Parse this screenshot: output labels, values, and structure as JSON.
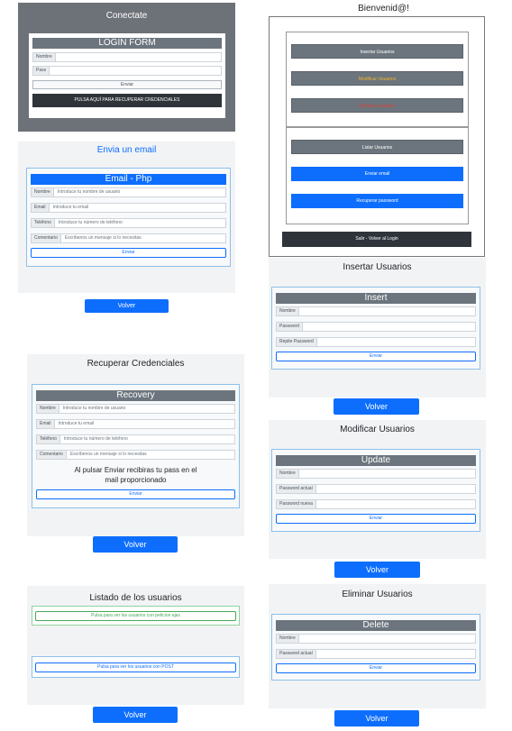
{
  "login": {
    "title": "Conectate",
    "form_title": "LOGIN FORM",
    "name_label": "Nombre",
    "pass_label": "Pass",
    "submit": "Enviar",
    "recover": "PULSA AQUÍ PARA RECUPERAR CREDENCIALES"
  },
  "menu": {
    "title": "Bienvenid@!",
    "items": [
      "Insertar Usuarios",
      "Modificar Usuarios",
      "Eliminar Usuarios"
    ],
    "list_users": "Listar Usuarios",
    "send_email": "Enviar email",
    "recover_password": "Recuperar password",
    "logout": "Salir - Volver al Login",
    "colors": {
      "modify": "#f0b429",
      "delete": "#e0413a"
    }
  },
  "email": {
    "title": "Envia un email",
    "form_title": "Email - Php",
    "fields": [
      {
        "label": "Nombre",
        "placeholder": "Introduce tu nombre de usuario"
      },
      {
        "label": "Email",
        "placeholder": "Introduce tu email"
      },
      {
        "label": "Teléfono",
        "placeholder": "Introduce tu número de teléfono"
      },
      {
        "label": "Comentario",
        "placeholder": "Escribenos un mensaje si lo necesitas"
      }
    ],
    "submit": "Enviar",
    "back": "Volver"
  },
  "insert": {
    "title": "Insertar Usuarios",
    "form_title": "Insert",
    "fields": [
      "Nombre",
      "Password",
      "Repite Password"
    ],
    "submit": "Enviar",
    "back": "Volver"
  },
  "recovery": {
    "title": "Recuperar Credenciales",
    "form_title": "Recovery",
    "fields": [
      {
        "label": "Nombre",
        "placeholder": "Introduce tu nombre de usuario"
      },
      {
        "label": "Email",
        "placeholder": "Introduce tu email"
      },
      {
        "label": "Teléfono",
        "placeholder": "Introduce tu número de teléfono"
      },
      {
        "label": "Comentario",
        "placeholder": "Escribenos un mensaje si lo necesitas"
      }
    ],
    "note": "Al pulsar Enviar recibiras tu pass en el mail proporcionado",
    "submit": "Enviar",
    "back": "Volver"
  },
  "modify": {
    "title": "Modificar Usuarios",
    "form_title": "Update",
    "fields": [
      "Nombre",
      "Password actual",
      "Password nueva"
    ],
    "submit": "Enviar",
    "back": "Volver"
  },
  "listing": {
    "title": "Listado de los usuarios",
    "ajax_button": "Pulsa para ver los usuarios con peticion ajax",
    "post_button": "Pulsa para ver los usuarios con POST",
    "back": "Volver"
  },
  "delete": {
    "title": "Eliminar Usuarios",
    "form_title": "Delete",
    "fields": [
      "Nombre",
      "Password actual"
    ],
    "submit": "Enviar",
    "back": "Volver"
  }
}
